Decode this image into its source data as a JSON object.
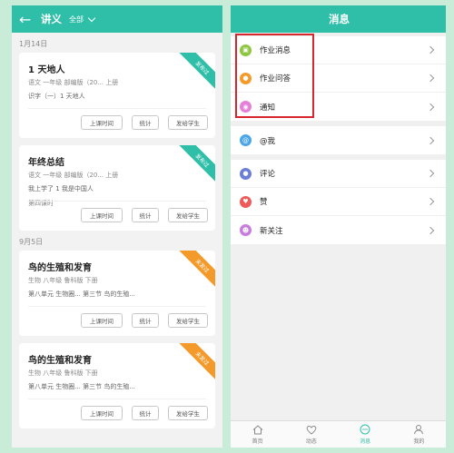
{
  "left": {
    "header": {
      "title": "讲义",
      "filter": "全部"
    },
    "sections": [
      {
        "date": "1月14日",
        "cards": [
          {
            "title": "1 天地人",
            "subtitle": "语文 一年级 部编版（20... 上册",
            "desc": "识字（一）1 天地人",
            "extra": "",
            "ribbon": "发布过"
          },
          {
            "title": "年终总结",
            "subtitle": "语文 一年级 部编版（20... 上册",
            "desc": "我上学了 1 我是中国人",
            "extra": "第四课时",
            "ribbon": "发布过"
          }
        ]
      },
      {
        "date": "9月5日",
        "cards": [
          {
            "title": "鸟的生殖和发育",
            "subtitle": "生物 八年级 鲁科版 下册",
            "desc": "第八单元 生物圈... 第三节 鸟的生殖...",
            "extra": "",
            "ribbon": "未发过"
          },
          {
            "title": "鸟的生殖和发育",
            "subtitle": "生物 八年级 鲁科版 下册",
            "desc": "第八单元 生物圈... 第三节 鸟的生殖...",
            "extra": "",
            "ribbon": "未发过"
          }
        ]
      }
    ],
    "buttons": {
      "time": "上课时间",
      "stats": "统计",
      "send": "发给学生"
    }
  },
  "right": {
    "header": {
      "title": "消息"
    },
    "groups": [
      [
        {
          "label": "作业消息",
          "icon": "homework-icon",
          "color": "#8dc63f"
        },
        {
          "label": "作业问答",
          "icon": "qa-icon",
          "color": "#f39a2b"
        },
        {
          "label": "通知",
          "icon": "notice-icon",
          "color": "#e57fd8"
        }
      ],
      [
        {
          "label": "@我",
          "icon": "at-icon",
          "color": "#4aa6e8"
        }
      ],
      [
        {
          "label": "评论",
          "icon": "comment-icon",
          "color": "#6c7fd8"
        },
        {
          "label": "赞",
          "icon": "like-icon",
          "color": "#ef5b5b"
        },
        {
          "label": "新关注",
          "icon": "follow-icon",
          "color": "#c87dde"
        }
      ]
    ],
    "tabs": [
      {
        "label": "首页",
        "icon": "home-icon"
      },
      {
        "label": "动态",
        "icon": "activity-icon"
      },
      {
        "label": "消息",
        "icon": "message-icon",
        "active": true
      },
      {
        "label": "我的",
        "icon": "profile-icon"
      }
    ],
    "highlight_color": "#d7262e"
  },
  "colors": {
    "accent": "#2fbfa9",
    "background": "#c9ecd9"
  }
}
